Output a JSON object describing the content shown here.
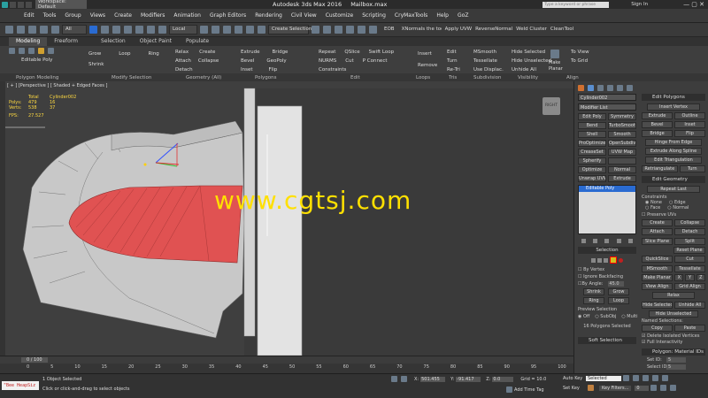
{
  "title_bar": {
    "workspace": "Workspace: Default",
    "app_title": "Autodesk 3ds Max 2016",
    "file_name": "Mailbox.max",
    "search_placeholder": "Type a keyword or phrase",
    "sign_in": "Sign In"
  },
  "menus": [
    "Edit",
    "Tools",
    "Group",
    "Views",
    "Create",
    "Modifiers",
    "Animation",
    "Graph Editors",
    "Rendering",
    "Civil View",
    "Customize",
    "Scripting",
    "CryMaxTools",
    "Help",
    "GoZ"
  ],
  "toolbar": {
    "filter": "All",
    "ref_coord": "Local",
    "selection_set": "Create Selection Se",
    "tools": [
      "EOB",
      "XNormals the toolbar",
      "Apply UVW",
      "ReverseNormals",
      "Weld Cluster",
      "CleanTool"
    ]
  },
  "ribbon_tabs": [
    "Modeling",
    "Freeform",
    "Selection",
    "Object Paint",
    "Populate"
  ],
  "ribbon": {
    "mode": "Editable Poly",
    "pm_items": [
      "Grow",
      "Shrink",
      "Loop",
      "Ring"
    ],
    "geom_items": [
      "Relax",
      "Create",
      "Attach",
      "Collapse",
      "Detach"
    ],
    "poly_items": [
      "Extrude",
      "Bevel",
      "Inset",
      "Bridge",
      "GeoPoly",
      "Flip"
    ],
    "edit_items": [
      "Repeat",
      "QSlice",
      "Swift Loop",
      "NURMS",
      "Cut",
      "P Connect",
      "Constraints"
    ],
    "loops_items": [
      "Insert",
      "Remove"
    ],
    "tris_items": [
      "Edit",
      "Turn",
      "Re-Tri"
    ],
    "subdiv_items": [
      "MSmooth",
      "Tessellate",
      "Use Displac."
    ],
    "vis_items": [
      "Hide Selected",
      "Hide Unselected",
      "Unhide All"
    ],
    "align_items": [
      "Make Planar",
      "To View",
      "To Grid"
    ],
    "group_labels": [
      "Polygon Modeling",
      "Modify Selection",
      "Geometry (All)",
      "Polygons",
      "Edit",
      "Loops",
      "Tris",
      "Subdivision",
      "Visibility",
      "Align"
    ]
  },
  "viewport": {
    "label": "[ + ] [Perspective ] [ Shaded + Edged Faces ]",
    "stats_headers": [
      "Total",
      "Cylinder002"
    ],
    "stats_rows": [
      {
        "name": "Polys:",
        "total": "479",
        "obj": "16"
      },
      {
        "name": "Verts:",
        "total": "538",
        "obj": "37"
      }
    ],
    "fps_label": "FPS:",
    "fps_value": "27.527",
    "viewcube": "RIGHT",
    "watermark": "www.cgtsj.com"
  },
  "command_panel": {
    "object_name": "Cylinder002",
    "modifier_list": "Modifier List",
    "modifier_buttons": [
      "Edit Poly",
      "Symmetry",
      "Bend",
      "TurboSmooth",
      "Shell",
      "Smooth",
      "ProOptimizer",
      "OpenSubdiv",
      "CreaseSet",
      "UVW Map",
      "Spherify",
      "",
      "Optimize",
      "Normal",
      "Unwrap UVW",
      "Extrude"
    ],
    "stack_item": "Editable Poly",
    "selection": {
      "title": "Selection",
      "by_vertex": "By Vertex",
      "ignore_backfacing": "Ignore Backfacing",
      "by_angle": "By Angle:",
      "by_angle_value": "45.0",
      "shrink": "Shrink",
      "grow": "Grow",
      "ring": "Ring",
      "loop": "Loop",
      "preview": "Preview Selection",
      "off": "Off",
      "subobj": "SubObj",
      "multi": "Multi",
      "status": "16 Polygons Selected"
    },
    "soft_selection": "Soft Selection"
  },
  "edit_panel": {
    "edit_polygons_title": "Edit Polygons",
    "insert_vertex": "Insert Vertex",
    "pairs": [
      [
        "Extrude",
        "Outline"
      ],
      [
        "Bevel",
        "Inset"
      ],
      [
        "Bridge",
        "Flip"
      ]
    ],
    "singles": [
      "Hinge From Edge",
      "Extrude Along Spline",
      "Edit Triangulation"
    ],
    "retri": [
      "Retriangulate",
      "Turn"
    ],
    "edit_geometry_title": "Edit Geometry",
    "repeat_last": "Repeat Last",
    "constraints": "Constraints",
    "c_none": "None",
    "c_edge": "Edge",
    "c_face": "Face",
    "c_normal": "Normal",
    "preserve_uvs": "Preserve UVs",
    "create": "Create",
    "collapse": "Collapse",
    "attach": "Attach",
    "detach": "Detach",
    "slice_plane": "Slice Plane",
    "split": "Split",
    "reset_plane": "Reset Plane",
    "quickslice": "QuickSlice",
    "cut": "Cut",
    "msmooth": "MSmooth",
    "tessellate": "Tessellate",
    "make_planar": "Make Planar",
    "x": "X",
    "y": "Y",
    "z": "Z",
    "view_align": "View Align",
    "grid_align": "Grid Align",
    "relax": "Relax",
    "hide_selected": "Hide Selected",
    "unhide_all": "Unhide All",
    "hide_unselected": "Hide Unselected",
    "named_selections": "Named Selections:",
    "copy": "Copy",
    "paste": "Paste",
    "delete_isolated": "Delete Isolated Vertices",
    "full_interactivity": "Full Interactivity",
    "material_ids_title": "Polygon: Material IDs",
    "set_id": "Set ID:",
    "set_id_value": "5",
    "select_id": "Select ID:",
    "select_id_value": "5"
  },
  "timeline": {
    "frame_label": "0 / 100",
    "ticks": [
      "0",
      "5",
      "10",
      "15",
      "20",
      "25",
      "30",
      "35",
      "40",
      "45",
      "50",
      "55",
      "60",
      "65",
      "70",
      "75",
      "80",
      "85",
      "90",
      "95",
      "100"
    ]
  },
  "status": {
    "maxscript": "\"Bee HeapSiz",
    "selected": "1 Object Selected",
    "prompt": "Click or click-and-drag to select objects",
    "x_label": "X:",
    "x": "501.455",
    "y_label": "Y:",
    "y": "-91.417",
    "z_label": "Z:",
    "z": "0.0",
    "grid": "Grid = 10.0",
    "add_time_tag": "Add Time Tag",
    "auto_key": "Auto Key",
    "key_mode": "Selected",
    "set_key": "Set Key",
    "key_filters": "Key Filters...",
    "frame": "0"
  },
  "colors": {
    "selected_poly": "#e05252",
    "watermark": "#ffe000",
    "accent": "#2a6bd1"
  }
}
